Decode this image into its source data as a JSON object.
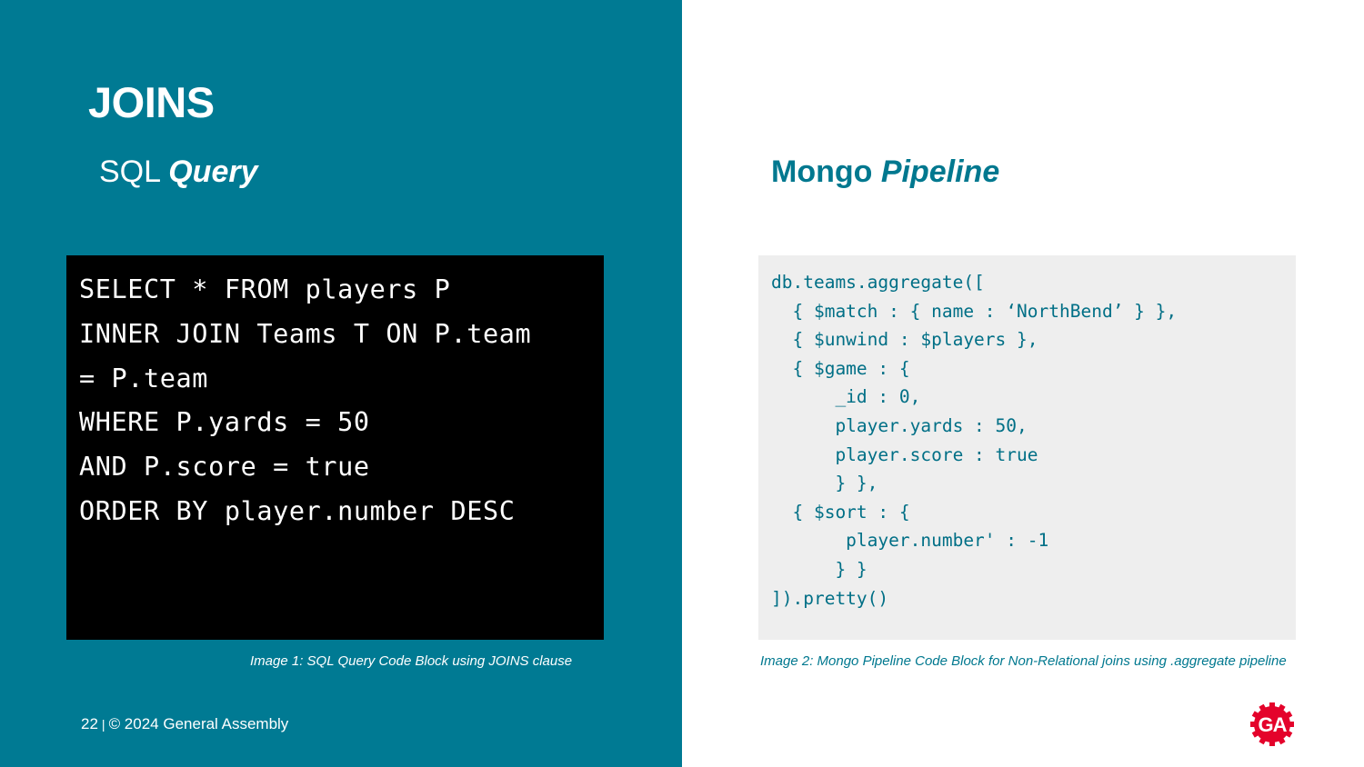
{
  "slide": {
    "title": "JOINS",
    "left_subhead": {
      "prefix": "SQL",
      "emphasis": "Query"
    },
    "right_subhead": {
      "prefix": "Mongo",
      "emphasis": "Pipeline"
    }
  },
  "sql_code": {
    "lines": [
      "SELECT * FROM players P",
      "INNER JOIN Teams T ON P.team",
      "= P.team",
      "WHERE P.yards = 50",
      "AND P.score = true",
      "ORDER BY player.number DESC"
    ]
  },
  "mongo_code": {
    "lines": [
      "db.teams.aggregate([",
      "  { $match : { name : ‘NorthBend’ } },",
      "  { $unwind : $players },",
      "  { $game : {",
      "      _id : 0,",
      "      player.yards : 50,",
      "      player.score : true",
      "      } },",
      "  { $sort : {",
      "       player.number' : -1",
      "      } }",
      "]).pretty()"
    ]
  },
  "captions": {
    "left": "Image 1: SQL Query Code Block using JOINS clause",
    "right": "Image 2: Mongo Pipeline Code Block for Non-Relational joins using .aggregate pipeline"
  },
  "footer": {
    "page_number": "22",
    "separator": "|",
    "copyright": "© 2024 General Assembly"
  },
  "logo": {
    "text": "GA",
    "icon": "general-assembly-logo-icon",
    "color": "#e4032b"
  },
  "colors": {
    "teal_panel": "#007a93",
    "teal_text": "#00788f",
    "code_dark_bg": "#000000",
    "code_light_bg": "#eeeeee"
  }
}
